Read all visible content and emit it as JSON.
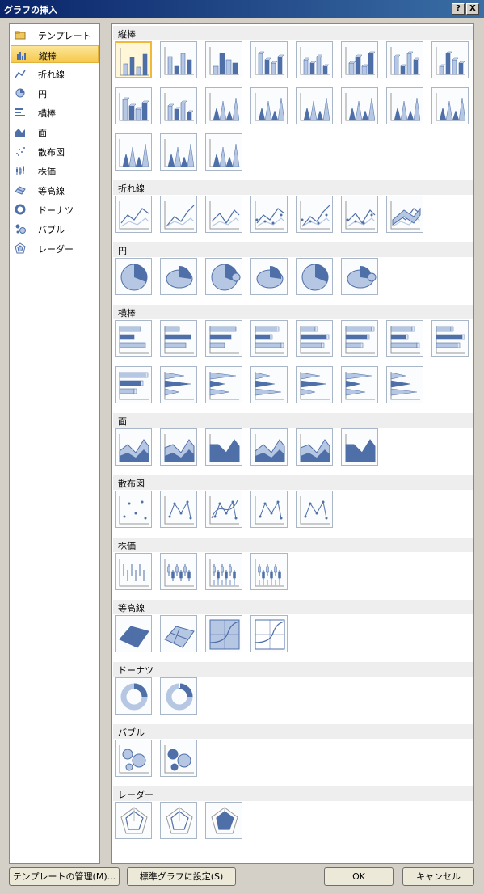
{
  "window": {
    "title": "グラフの挿入",
    "help_label": "?",
    "close_label": "X"
  },
  "categories": [
    {
      "label": "テンプレート",
      "icon": "folder-icon"
    },
    {
      "label": "縦棒",
      "icon": "column-chart-icon"
    },
    {
      "label": "折れ線",
      "icon": "line-chart-icon"
    },
    {
      "label": "円",
      "icon": "pie-chart-icon"
    },
    {
      "label": "横棒",
      "icon": "bar-chart-icon"
    },
    {
      "label": "面",
      "icon": "area-chart-icon"
    },
    {
      "label": "散布図",
      "icon": "scatter-chart-icon"
    },
    {
      "label": "株価",
      "icon": "stock-chart-icon"
    },
    {
      "label": "等高線",
      "icon": "surface-chart-icon"
    },
    {
      "label": "ドーナツ",
      "icon": "doughnut-chart-icon"
    },
    {
      "label": "バブル",
      "icon": "bubble-chart-icon"
    },
    {
      "label": "レーダー",
      "icon": "radar-chart-icon"
    }
  ],
  "selected_category": "縦棒",
  "sections": [
    {
      "title": "縦棒",
      "kind": "column",
      "count": 19
    },
    {
      "title": "折れ線",
      "kind": "line",
      "count": 7
    },
    {
      "title": "円",
      "kind": "pie",
      "count": 6
    },
    {
      "title": "横棒",
      "kind": "bar",
      "count": 15
    },
    {
      "title": "面",
      "kind": "area",
      "count": 6
    },
    {
      "title": "散布図",
      "kind": "scatter",
      "count": 5
    },
    {
      "title": "株価",
      "kind": "stock",
      "count": 4
    },
    {
      "title": "等高線",
      "kind": "surface",
      "count": 4
    },
    {
      "title": "ドーナツ",
      "kind": "doughnut",
      "count": 2
    },
    {
      "title": "バブル",
      "kind": "bubble",
      "count": 2
    },
    {
      "title": "レーダー",
      "kind": "radar",
      "count": 3
    }
  ],
  "buttons": {
    "manage_templates": "テンプレートの管理(M)...",
    "set_default": "標準グラフに設定(S)",
    "ok": "OK",
    "cancel": "キャンセル"
  },
  "colors": {
    "accent": "#4f6fa8",
    "light": "#b6c7e3",
    "selection": "#f7c84a",
    "titlebar": "#0a246a"
  }
}
